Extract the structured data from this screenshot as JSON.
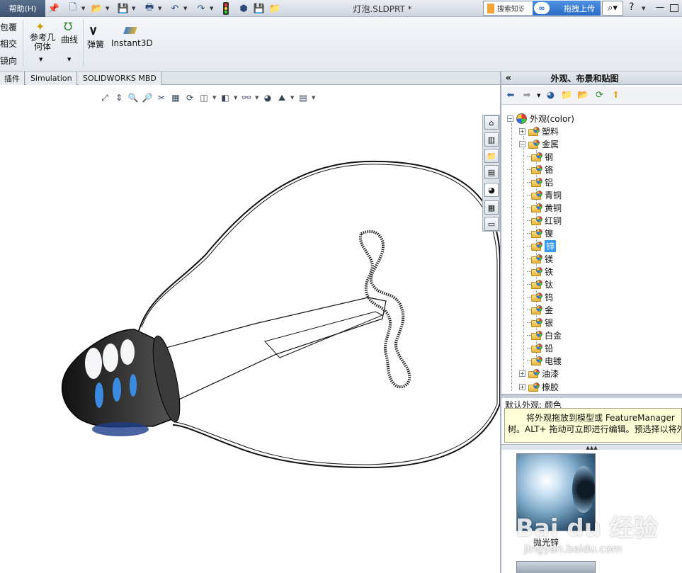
{
  "menu": {
    "help_label": "帮助(H)"
  },
  "document": {
    "title": "灯泡.SLDPRT *"
  },
  "search": {
    "placeholder_text": "搜索知识",
    "upload_label": "拖拽上传",
    "cloud_glyph": "∞"
  },
  "window_controls": {
    "help": "?",
    "minimize": "—"
  },
  "ribbon": {
    "left_items": [
      "包覆",
      "相交",
      "镜向"
    ],
    "ref_geometry": "参考几何体",
    "curves": "曲线",
    "spring": "弹簧",
    "instant3d": "Instant3D"
  },
  "tabs": [
    {
      "label": "插件"
    },
    {
      "label": "Simulation"
    },
    {
      "label": "SOLIDWORKS MBD"
    }
  ],
  "panel": {
    "title": "外观、布景和贴图",
    "collapse_glyph": "«"
  },
  "tree": {
    "root": "外观(color)",
    "plastic": "塑料",
    "metal": "金属",
    "metal_children": [
      "钢",
      "铬",
      "铝",
      "青铜",
      "黄铜",
      "红铜",
      "镍",
      "锌",
      "镁",
      "铁",
      "钛",
      "钨",
      "金",
      "银",
      "白金",
      "铅",
      "电镀"
    ],
    "selected_index": 7,
    "paint": "油漆",
    "rubber": "橡胶"
  },
  "default_appearance": "默认外观: 颜色",
  "hint": {
    "line1": "将外观拖放到模型或 FeatureManager",
    "line2": "树。ALT+ 拖动可立即进行编辑。预选择以将外"
  },
  "swatch": {
    "label": "抛光锌"
  },
  "watermark": {
    "text": "Bai du 经验",
    "url_text": "jingyan.baidu.com"
  },
  "colors": {
    "selection": "#3399ff",
    "upload_button": "#2c6cc4",
    "bulb_outline": "#111111"
  }
}
